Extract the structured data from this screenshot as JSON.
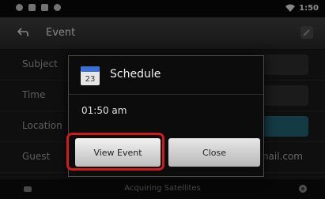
{
  "status_bar": {
    "time": "1:50",
    "icons": [
      "usb-icon",
      "settings-icon",
      "image-icon",
      "record-icon",
      "wifi-icon"
    ]
  },
  "title_bar": {
    "title": "Event",
    "back_icon": "back-icon"
  },
  "background_rows": [
    {
      "label": "Subject",
      "value": ""
    },
    {
      "label": "Time",
      "value": ""
    },
    {
      "label": "Location",
      "value": ""
    },
    {
      "label": "Guest",
      "value": "mail.com"
    }
  ],
  "dialog": {
    "title": "Schedule",
    "time": "01:50 am",
    "buttons": {
      "view": "View Event",
      "close": "Close"
    },
    "highlight_color": "#d11a1a"
  },
  "bottom_bar": {
    "text": "Acquiring Satellites"
  }
}
